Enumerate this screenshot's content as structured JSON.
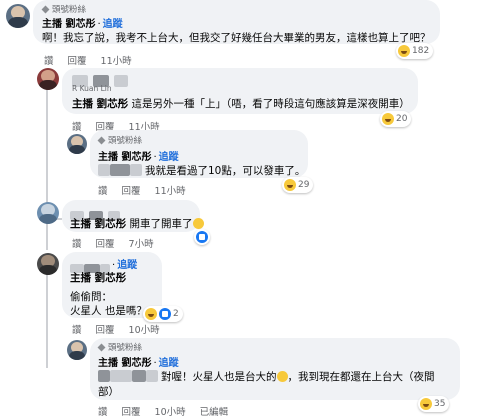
{
  "comments": [
    {
      "fan_badge": "頭號粉絲",
      "author": "主播 劉芯彤",
      "follow": "追蹤",
      "text": "啊！我忘了說，我考不上台大，但我交了好幾任台大畢業的男友，這樣也算上了吧？",
      "like": "讚",
      "reply": "回覆",
      "time": "11小時",
      "reaction_count": "182"
    },
    {
      "author_small": "R Kuan Lin",
      "tag": "主播 劉芯彤",
      "text": "這是另外一種「上」（唔，看了時段這句應該算是深夜開車）",
      "like": "讚",
      "reply": "回覆",
      "time": "11小時",
      "reaction_count": "20"
    },
    {
      "fan_badge": "頭號粉絲",
      "author": "主播 劉芯彤",
      "follow": "追蹤",
      "text": "我就是看過了10點，可以發車了。",
      "like": "讚",
      "reply": "回覆",
      "time": "11小時",
      "reaction_count": "29"
    },
    {
      "tag": "主播 劉芯彤",
      "text": "開車了開車了",
      "like": "讚",
      "reply": "回覆",
      "time": "7小時"
    },
    {
      "tag": "主播 劉芯彤",
      "follow": "追蹤",
      "text_line1": "偷偷問：",
      "text_line2": "火星人 也是嗎？",
      "reaction_count": "2",
      "like": "讚",
      "reply": "回覆",
      "time": "10小時"
    },
    {
      "fan_badge": "頭號粉絲",
      "author": "主播 劉芯彤",
      "follow": "追蹤",
      "text_line1": "對喔！火星人也是台大的",
      "text_line1b": "，我到現在都還在上台大（夜間",
      "text_line2": "部）",
      "like": "讚",
      "reply": "回覆",
      "time": "10小時",
      "edited": "已編輯",
      "reaction_count": "35"
    }
  ]
}
